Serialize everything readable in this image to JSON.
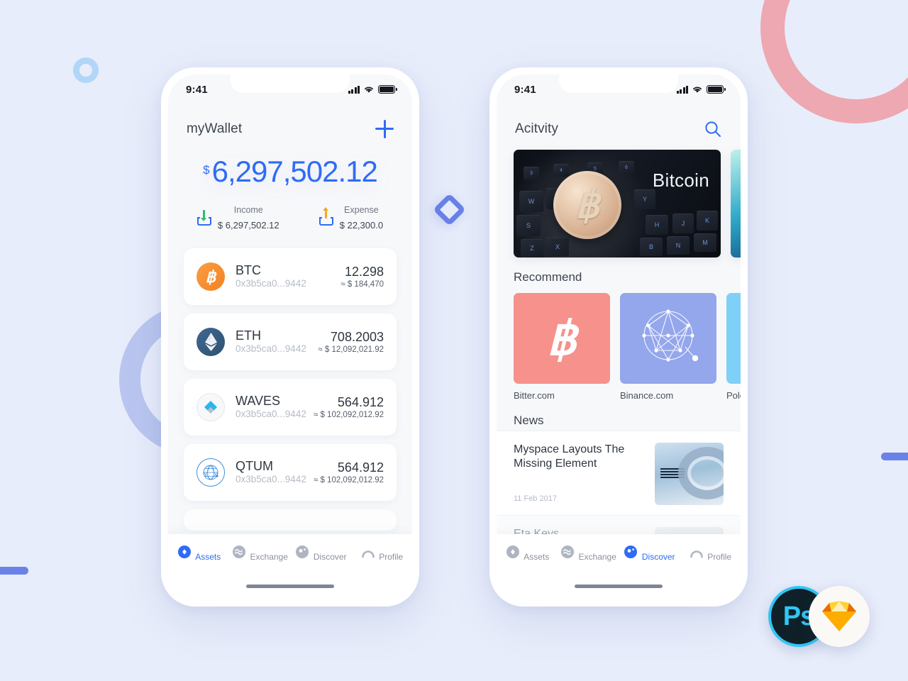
{
  "background": {
    "color": "#e8edfb",
    "decorations": [
      {
        "name": "pink-ring",
        "color": "#eda8b2"
      },
      {
        "name": "periwinkle-ring",
        "color": "#bac6f0"
      },
      {
        "name": "blue-donut",
        "color": "#b1d6f7"
      },
      {
        "name": "blue-bar-left",
        "color": "#6a82e8"
      },
      {
        "name": "blue-bar-right",
        "color": "#6a82e8"
      },
      {
        "name": "blue-diamond",
        "color": "#6a82e8"
      }
    ]
  },
  "badges": {
    "photoshop_label": "Ps",
    "photoshop_color": "#31c5f4",
    "sketch_label": "sketch-diamond-icon"
  },
  "wallet_screen": {
    "status": {
      "time": "9:41"
    },
    "header": {
      "title": "myWallet",
      "add_icon": "plus-icon"
    },
    "balance": {
      "currency_symbol": "$",
      "amount": "6,297,502.12",
      "color": "#2f6bf5"
    },
    "flows": [
      {
        "icon": "income-tray-icon",
        "label": "Income",
        "value": "$ 6,297,502.12",
        "arrow_color": "#2bbd6e"
      },
      {
        "icon": "expense-tray-icon",
        "label": "Expense",
        "value": "$ 22,300.0",
        "arrow_color": "#f5a623"
      }
    ],
    "assets": [
      {
        "icon": "bitcoin-icon",
        "symbol": "BTC",
        "address": "0x3b5ca0...9442",
        "amount": "12.298",
        "fiat": "≈ $ 184,470"
      },
      {
        "icon": "ethereum-icon",
        "symbol": "ETH",
        "address": "0x3b5ca0...9442",
        "amount": "708.2003",
        "fiat": "≈ $ 12,092,021.92"
      },
      {
        "icon": "waves-icon",
        "symbol": "WAVES",
        "address": "0x3b5ca0...9442",
        "amount": "564.912",
        "fiat": "≈ $ 102,092,012.92"
      },
      {
        "icon": "qtum-icon",
        "symbol": "QTUM",
        "address": "0x3b5ca0...9442",
        "amount": "564.912",
        "fiat": "≈ $ 102,092,012.92"
      }
    ],
    "tabs": [
      {
        "icon": "assets-icon",
        "label": "Assets",
        "active": true
      },
      {
        "icon": "exchange-icon",
        "label": "Exchange",
        "active": false
      },
      {
        "icon": "discover-icon",
        "label": "Discover",
        "active": false
      },
      {
        "icon": "profile-icon",
        "label": "Profile",
        "active": false
      }
    ]
  },
  "discover_screen": {
    "status": {
      "time": "9:41"
    },
    "header": {
      "title": "Acitvity",
      "search_icon": "search-icon"
    },
    "banner": {
      "caption": "Bitcoin",
      "image": "bitcoin-coin-on-keyboard-photo"
    },
    "recommend": {
      "title": "Recommend",
      "items": [
        {
          "label": "Bitter.com",
          "color": "#f6918c",
          "icon": "bitcoin-b-icon"
        },
        {
          "label": "Binance.com",
          "color": "#94a6ec",
          "icon": "polygon-mesh-icon"
        },
        {
          "label": "Polon",
          "color": "#7fd0f7",
          "icon": "partial-icon"
        }
      ]
    },
    "news": {
      "title": "News",
      "items": [
        {
          "title": "Myspace Layouts The Missing Element",
          "date": "11 Feb 2017",
          "thumb": "ibm-server-photo"
        },
        {
          "title": "Eta Keys",
          "date": "",
          "thumb": "portrait-photo"
        }
      ]
    },
    "tabs": [
      {
        "icon": "assets-icon",
        "label": "Assets",
        "active": false
      },
      {
        "icon": "exchange-icon",
        "label": "Exchange",
        "active": false
      },
      {
        "icon": "discover-icon",
        "label": "Discover",
        "active": true
      },
      {
        "icon": "profile-icon",
        "label": "Profile",
        "active": false
      }
    ]
  }
}
